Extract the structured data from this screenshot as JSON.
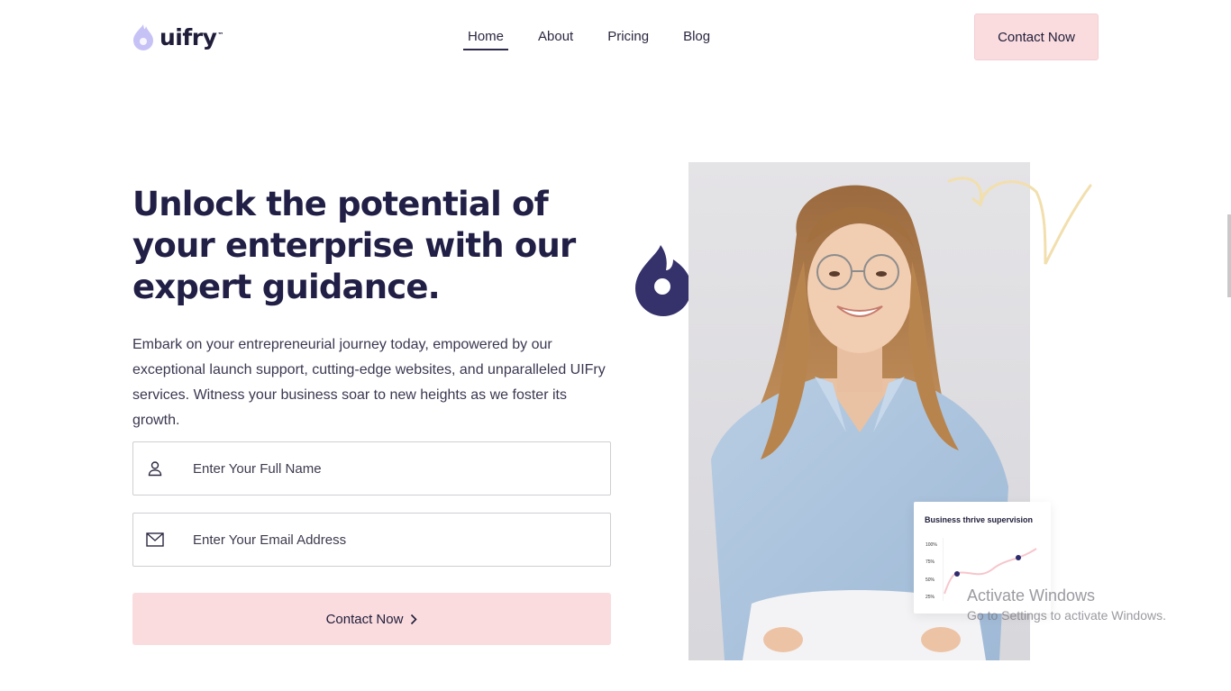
{
  "header": {
    "logo": {
      "text": "uifry",
      "tm": "™",
      "icon": "flame-logo-icon",
      "color": "#b9b4f2"
    },
    "nav": [
      {
        "label": "Home",
        "active": true
      },
      {
        "label": "About",
        "active": false
      },
      {
        "label": "Pricing",
        "active": false
      },
      {
        "label": "Blog",
        "active": false
      }
    ],
    "cta_label": "Contact Now"
  },
  "hero": {
    "title": "Unlock the potential of your enterprise with our expert guidance.",
    "description": "Embark on your entrepreneurial journey today, empowered by our exceptional launch support, cutting-edge websites, and unparalleled UIFry services. Witness your business soar to new heights as we foster its growth.",
    "form": {
      "name_placeholder": "Enter Your Full Name",
      "name_icon": "user-icon",
      "email_placeholder": "Enter Your Email Address",
      "email_icon": "mail-icon",
      "submit_label": "Contact Now",
      "submit_icon": "chevron-right-icon"
    }
  },
  "visual": {
    "photo": "smiling-woman-portrait",
    "flame_color": "#35316b",
    "scribble_color": "#f2dfae",
    "card": {
      "title": "Business thrive supervision",
      "y_ticks": [
        "100%",
        "75%",
        "50%",
        "25%"
      ],
      "line_color": "#f6c6cc",
      "point_color": "#2d2a6e"
    }
  },
  "overlay": {
    "watermark_title": "Activate Windows",
    "watermark_sub": "Go to Settings to activate Windows."
  },
  "colors": {
    "accent_pink": "#fadcde",
    "text_dark": "#211f45"
  }
}
